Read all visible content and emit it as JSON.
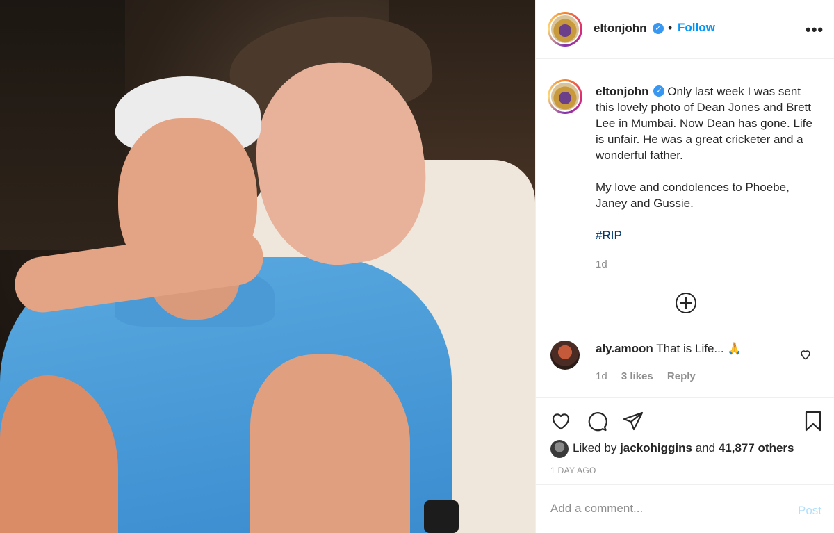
{
  "post": {
    "author": {
      "username": "eltonjohn",
      "verified_icon": "verified-badge-icon",
      "follow_label": "Follow",
      "separator": "•",
      "more_label": "•••"
    },
    "caption": {
      "line_1": "Only last week I was sent this lovely photo of Dean Jones and Brett Lee in Mumbai. Now Dean has gone. Life is unfair. He was a great cricketer and a wonderful father.",
      "line_2": "My love and condolences to Phoebe, Janey and Gussie.",
      "hashtag": "#RIP",
      "time": "1d"
    },
    "comments": [
      {
        "username": "aly.amoon",
        "text": "That is Life... 🙏",
        "time": "1d",
        "likes": "3 likes",
        "reply_label": "Reply"
      }
    ],
    "likes": {
      "prefix": "Liked by",
      "user": "jackohiggins",
      "joiner": "and",
      "others": "41,877 others"
    },
    "timestamp": "1 DAY AGO",
    "add_comment": {
      "placeholder": "Add a comment...",
      "post_label": "Post"
    },
    "icons": [
      "plus-circle-icon",
      "heart-icon",
      "comment-icon",
      "share-icon",
      "bookmark-icon"
    ]
  }
}
